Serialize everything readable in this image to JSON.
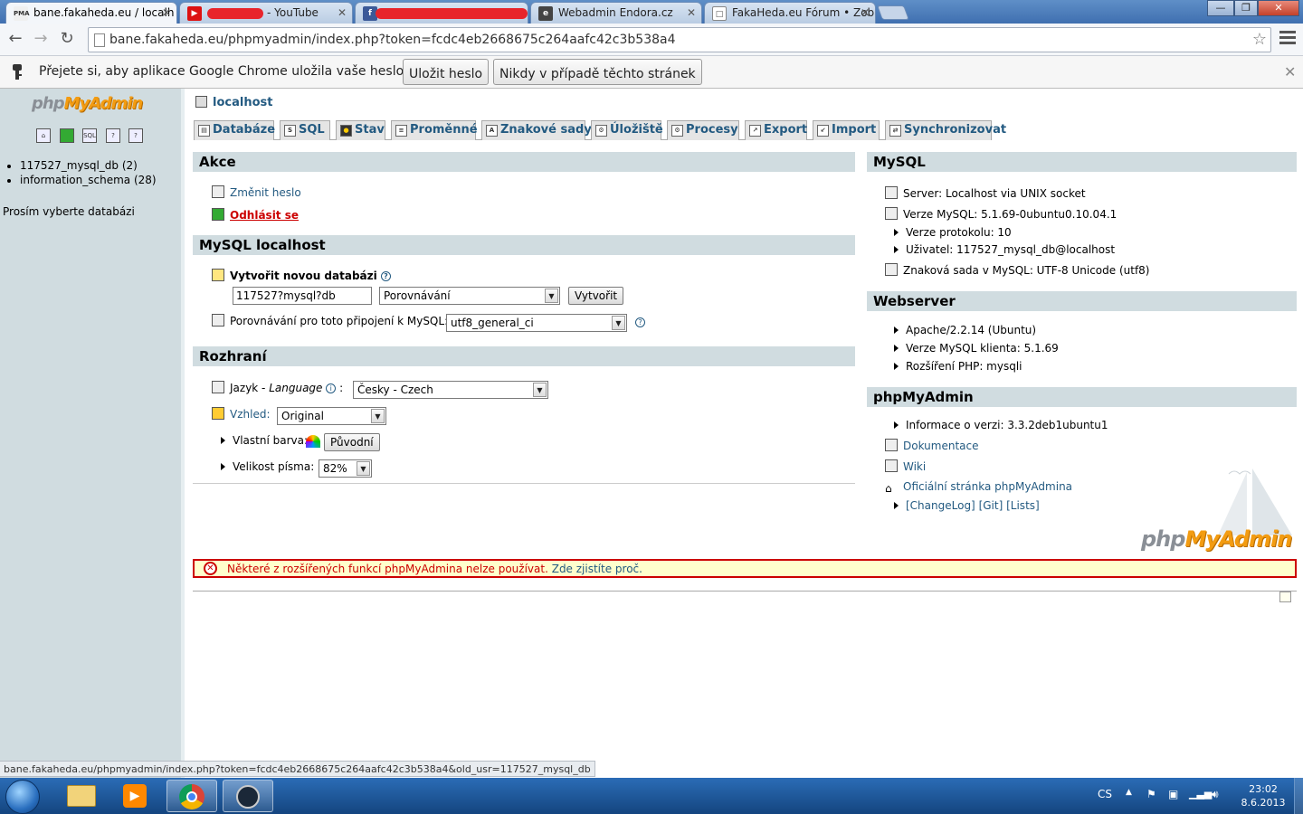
{
  "browser": {
    "tabs": [
      {
        "title": "bane.fakaheda.eu / localh",
        "favicon": "PMA"
      },
      {
        "title": "- YouTube",
        "favicon": "youtube-icon"
      },
      {
        "title": "",
        "favicon": "facebook-icon"
      },
      {
        "title": "Webadmin Endora.cz",
        "favicon": "endora-icon"
      },
      {
        "title": "FakaHeda.eu Fórum • Zob",
        "favicon": "page-icon"
      }
    ],
    "url": "bane.fakaheda.eu/phpmyadmin/index.php?token=fcdc4eb2668675c264aafc42c3b538a4",
    "infobar": {
      "message": "Přejete si, aby aplikace Google Chrome uložila vaše heslo?",
      "save_label": "Uložit heslo",
      "never_label": "Nikdy v případě těchto stránek"
    },
    "status_url": "bane.fakaheda.eu/phpmyadmin/index.php?token=fcdc4eb2668675c264aafc42c3b538a4&old_usr=117527_mysql_db"
  },
  "sidebar": {
    "logo_php": "php",
    "logo_myadmin": "MyAdmin",
    "databases": [
      "117527_mysql_db (2)",
      "information_schema (28)"
    ],
    "choose": "Prosím vyberte databázi"
  },
  "server": {
    "name": "localhost"
  },
  "tabs": [
    {
      "label": "Databáze"
    },
    {
      "label": "SQL"
    },
    {
      "label": "Stav"
    },
    {
      "label": "Proměnné"
    },
    {
      "label": "Znakové sady"
    },
    {
      "label": "Úložiště"
    },
    {
      "label": "Procesy"
    },
    {
      "label": "Export"
    },
    {
      "label": "Import"
    },
    {
      "label": "Synchronizovat"
    }
  ],
  "akce": {
    "title": "Akce",
    "change_password": "Změnit heslo",
    "logout": "Odhlásit se"
  },
  "mysql_local": {
    "title": "MySQL localhost",
    "create_db_label": "Vytvořit novou databázi",
    "db_name_value": "117527?mysql?db",
    "collation_value": "Porovnávání",
    "create_button": "Vytvořit",
    "connection_collation_label": "Porovnávání pro toto připojení k MySQL:",
    "connection_collation_value": "utf8_general_ci"
  },
  "rozhrani": {
    "title": "Rozhraní",
    "language_label": "Jazyk - ",
    "language_label_en": "Language",
    "language_value": "Česky - Czech",
    "theme_label": "Vzhled:",
    "theme_value": "Original",
    "custom_color_label": "Vlastní barva:",
    "reset_button": "Původní",
    "font_size_label": "Velikost písma:",
    "font_size_value": "82%"
  },
  "mysql_info": {
    "title": "MySQL",
    "server": "Server: Localhost via UNIX socket",
    "version": "Verze MySQL: 5.1.69-0ubuntu0.10.04.1",
    "protocol": "Verze protokolu: 10",
    "user": "Uživatel: 117527_mysql_db@localhost",
    "charset": "Znaková sada v MySQL: UTF-8 Unicode (utf8)"
  },
  "webserver": {
    "title": "Webserver",
    "apache": "Apache/2.2.14 (Ubuntu)",
    "client": "Verze MySQL klienta: 5.1.69",
    "php_ext": "Rozšíření PHP: mysqli"
  },
  "pma": {
    "title": "phpMyAdmin",
    "version": "Informace o verzi: 3.3.2deb1ubuntu1",
    "docs": "Dokumentace",
    "wiki": "Wiki",
    "homepage": "Oficiální stránka phpMyAdmina",
    "changelog": "[ChangeLog]",
    "git": "[Git]",
    "lists": "[Lists]"
  },
  "error": {
    "message": "Některé z rozšířených funkcí phpMyAdmina nelze používat.",
    "link": "Zde zjistíte proč."
  },
  "taskbar": {
    "lang": "CS",
    "time": "23:02",
    "date": "8.6.2013"
  },
  "colors": {
    "accent": "#235a81",
    "panel": "#d0dce0",
    "error": "#cc0000"
  }
}
